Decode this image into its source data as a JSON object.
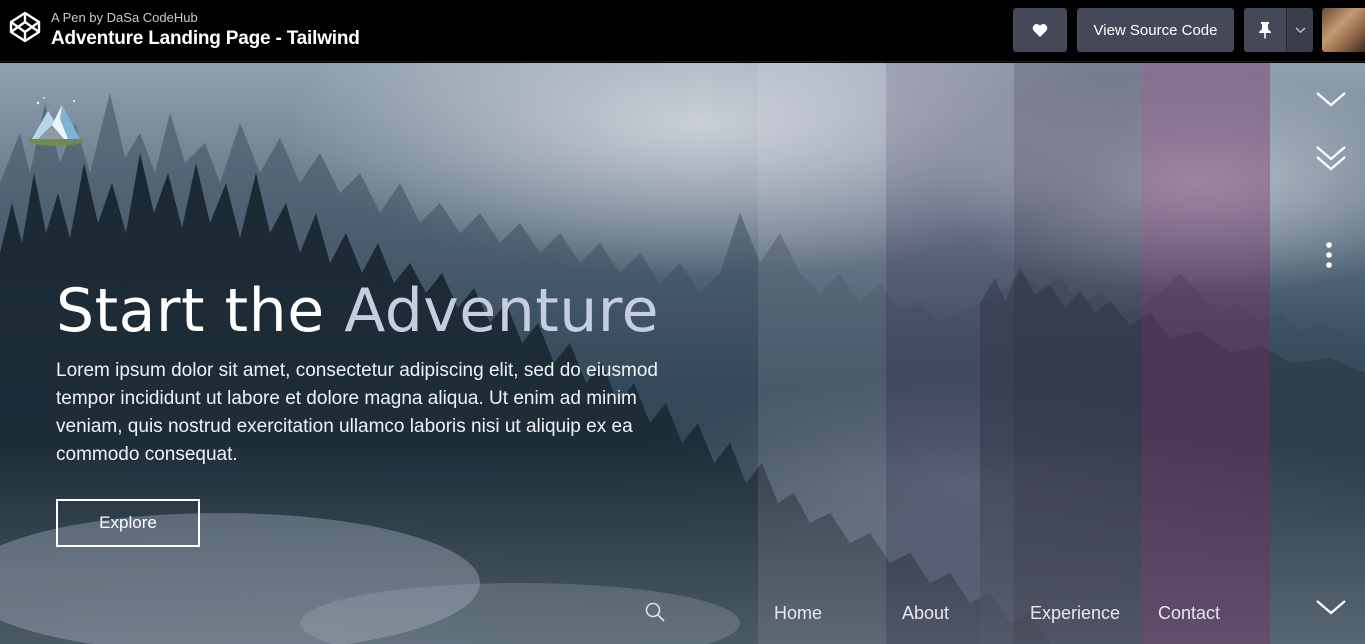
{
  "topbar": {
    "pen_by": "A Pen by DaSa CodeHub",
    "title": "Adventure Landing Page - Tailwind",
    "view_source_label": "View Source Code",
    "icons": [
      "codepen-logo-icon",
      "heart-icon",
      "pin-icon",
      "chevron-down-icon",
      "user-avatar"
    ]
  },
  "hero": {
    "headline_part1": "Start the",
    "headline_part2": "Adventure",
    "lead": "Lorem ipsum dolor sit amet, consectetur adipiscing elit, sed do eiusmod tempor incididunt ut labore et dolore magna aliqua. Ut enim ad minim veniam, quis nostrud exercitation ullamco laboris nisi ut aliquip ex ea commodo consequat.",
    "explore_label": "Explore"
  },
  "nav": {
    "items": [
      {
        "label": "Home"
      },
      {
        "label": "About"
      },
      {
        "label": "Experience"
      },
      {
        "label": "Contact"
      }
    ]
  },
  "side_icons": [
    "chevron-down-icon",
    "double-chevron-down-icon",
    "more-vertical-icon",
    "chevron-down-icon"
  ],
  "colors": {
    "topbar_bg": "#000000",
    "button_bg": "#444857",
    "headline_accent": "#c5cde0",
    "stripe_accent": "#7a2864"
  }
}
